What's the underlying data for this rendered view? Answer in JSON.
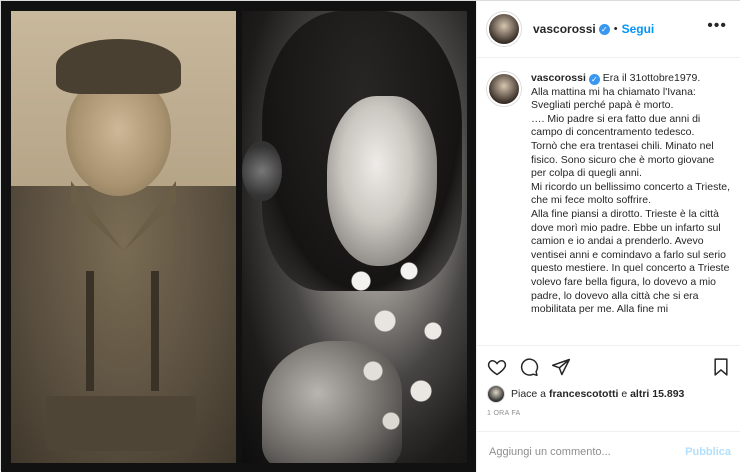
{
  "post": {
    "author": "vascorossi",
    "follow_label": "Segui",
    "separator": "•",
    "more_glyph": "•••",
    "caption": "Era il 31ottobre1979.\nAlla mattina mi ha chiamato l'Ivana:\nSvegliati perché papà è morto.\n…. Mio padre si era fatto due anni di campo di concentramento tedesco.\nTornò che era trentasei chili. Minato nel fisico. Sono sicuro che è morto giovane per colpa di quegli anni.\nMi ricordo un bellissimo concerto a Trieste, che mi fece molto soffrire.\nAlla fine piansi a dirotto. Trieste è la città dove morì mio padre. Ebbe un infarto sul camion e io andai a prenderlo. Avevo ventisei anni e comindavo a farlo sul serio questo mestiere. In quel concerto a Trieste volevo fare bella figura, lo dovevo a mio padre, lo dovevo alla città che si era mobilitata per me. Alla fine mi",
    "likes_prefix": "Piace a",
    "likes_user": "francescototti",
    "likes_and": "e",
    "likes_others": "altri 15.893",
    "timestamp": "1 ORA FA"
  },
  "comment": {
    "placeholder": "Aggiungi un commento...",
    "publish_label": "Pubblica"
  },
  "icons": {
    "like": "heart-icon",
    "comment": "comment-icon",
    "share": "paper-plane-icon",
    "save": "bookmark-icon",
    "verified": "verified-badge-icon"
  },
  "colors": {
    "accent": "#0095f6",
    "verified": "#3897f0",
    "publish_disabled": "#b2dffc",
    "text": "#262626",
    "muted": "#8e8e8e"
  }
}
